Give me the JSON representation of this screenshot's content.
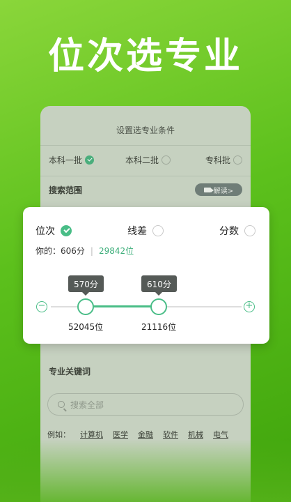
{
  "headline": "位次选专业",
  "card": {
    "title": "设置选专业条件",
    "batches": [
      {
        "label": "本科一批",
        "selected": true
      },
      {
        "label": "本科二批",
        "selected": false
      },
      {
        "label": "专科批",
        "selected": false
      }
    ],
    "search_range_label": "搜索范围",
    "guide_label": "解读>",
    "keyword_label": "专业关键词",
    "search_placeholder": "搜索全部",
    "examples_label": "例如：",
    "example_tags": [
      "计算机",
      "医学",
      "金融",
      "软件",
      "机械",
      "电气"
    ]
  },
  "panel": {
    "modes": [
      {
        "label": "位次",
        "selected": true
      },
      {
        "label": "线差",
        "selected": false
      },
      {
        "label": "分数",
        "selected": false
      }
    ],
    "mine_label": "你的：",
    "my_score": "606分",
    "my_rank": "29842位",
    "range": {
      "low_score": "570分",
      "high_score": "610分",
      "low_rank": "52045位",
      "high_rank": "21116位"
    },
    "minus": "−",
    "plus": "+"
  },
  "colors": {
    "accent": "#49bd87",
    "background_green": "#5cc01c"
  }
}
